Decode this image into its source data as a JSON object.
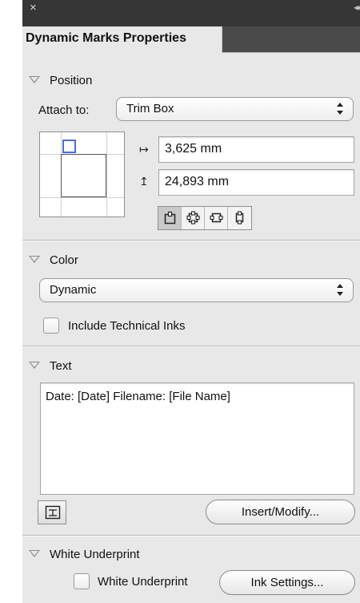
{
  "panel": {
    "tab_title": "Dynamic Marks Properties",
    "close_glyph": "×",
    "collapse_glyph": "◂◂"
  },
  "position": {
    "header": "Position",
    "attach_label": "Attach to:",
    "attach_value": "Trim Box",
    "x_offset": "3,625 mm",
    "y_offset": "24,893 mm",
    "x_icon": "↦",
    "y_icon": "↥",
    "anchor_buttons": [
      "anchor-inside-icon",
      "anchor-center-icon",
      "anchor-horizontal-icon",
      "anchor-vertical-icon"
    ]
  },
  "color": {
    "header": "Color",
    "value": "Dynamic",
    "include_technical_inks": "Include Technical Inks"
  },
  "text": {
    "header": "Text",
    "content": "Date: [Date]  Filename: [File Name]",
    "insert_modify": "Insert/Modify..."
  },
  "white_underprint": {
    "header": "White Underprint",
    "checkbox_label": "White Underprint",
    "ink_settings": "Ink Settings..."
  },
  "colors": {
    "title_bar": "#363636",
    "panel_bg": "#e8e8e8",
    "anchor_blue": "#4a6ce0"
  }
}
